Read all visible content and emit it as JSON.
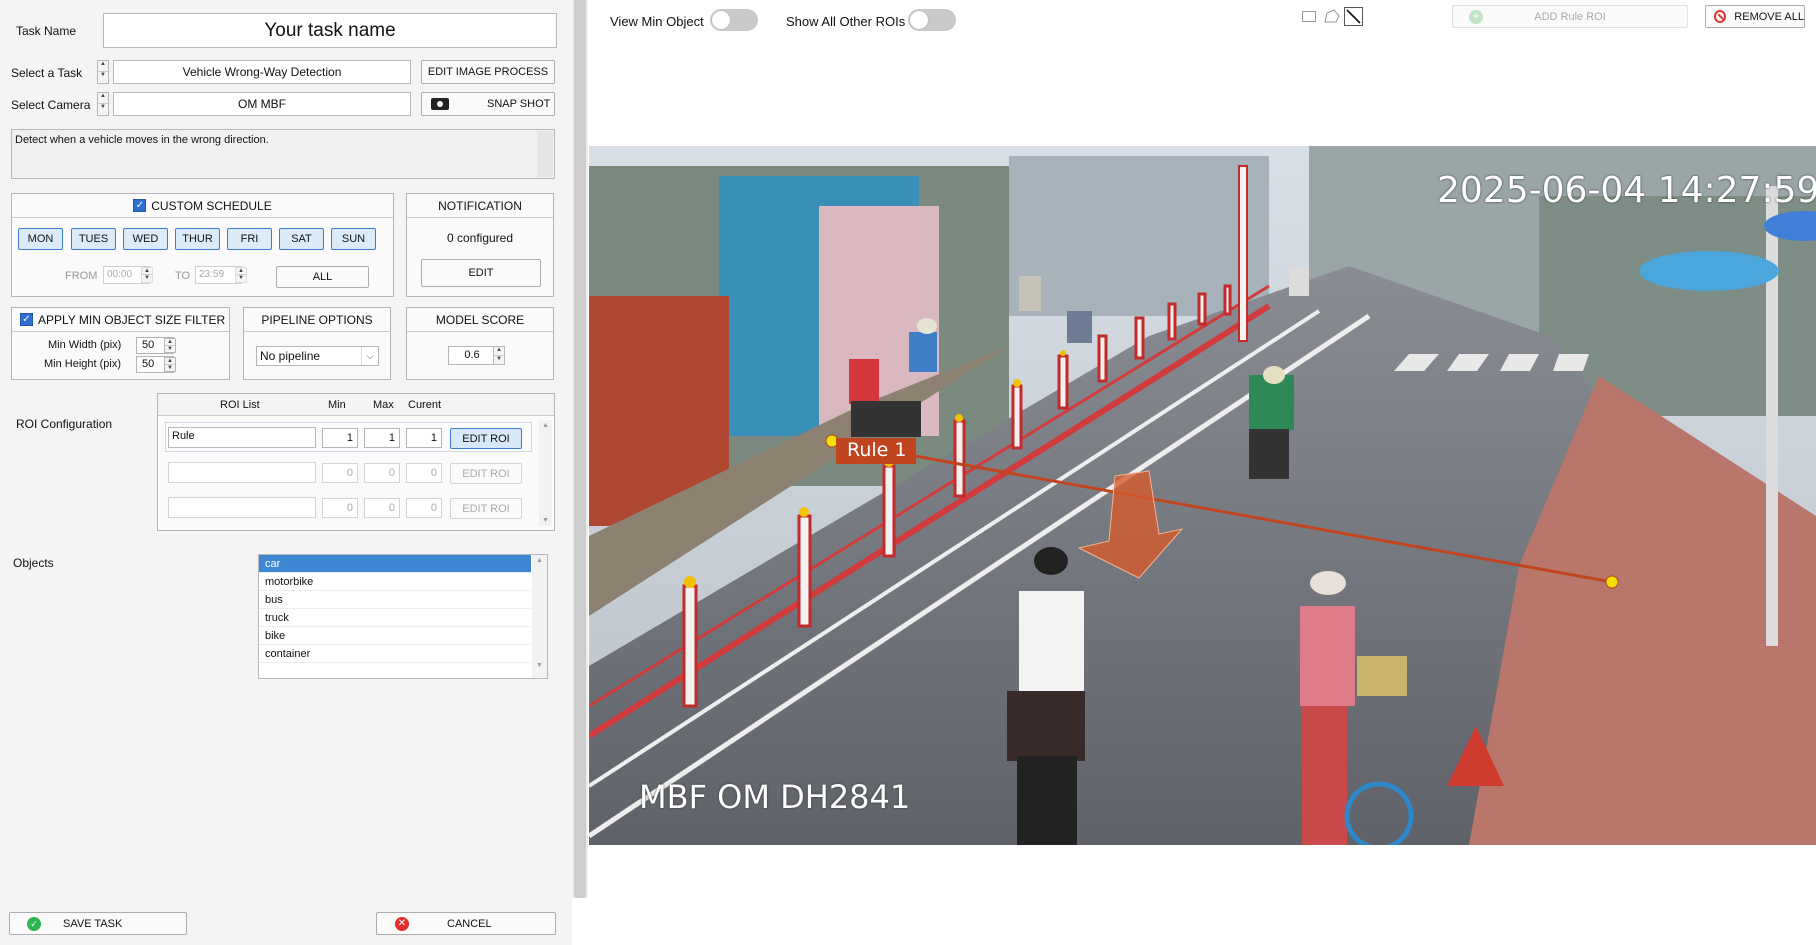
{
  "task": {
    "name_label": "Task Name",
    "name_value": "Your task name",
    "select_task_label": "Select a Task",
    "select_task_value": "Vehicle Wrong-Way Detection",
    "edit_image_process": "EDIT IMAGE PROCESS",
    "select_camera_label": "Select Camera",
    "select_camera_value": "OM MBF",
    "snap_shot": "SNAP SHOT",
    "description": "Detect when a vehicle moves in the wrong direction."
  },
  "schedule": {
    "title": "CUSTOM SCHEDULE",
    "days": [
      "MON",
      "TUES",
      "WED",
      "THUR",
      "FRI",
      "SAT",
      "SUN"
    ],
    "from_label": "FROM",
    "from_value": "00:00",
    "to_label": "TO",
    "to_value": "23:59",
    "all_label": "ALL"
  },
  "notification": {
    "title": "NOTIFICATION",
    "status": "0 configured",
    "edit_label": "EDIT"
  },
  "size_filter": {
    "title": "APPLY MIN OBJECT SIZE FILTER",
    "min_width_label": "Min Width (pix)",
    "min_width_value": "50",
    "min_height_label": "Min Height (pix)",
    "min_height_value": "50"
  },
  "pipeline": {
    "title": "PIPELINE OPTIONS",
    "value": "No pipeline"
  },
  "model_score": {
    "title": "MODEL SCORE",
    "value": "0.6"
  },
  "roi": {
    "section_label": "ROI Configuration",
    "headers": {
      "list": "ROI List",
      "min": "Min",
      "max": "Max",
      "current": "Curent"
    },
    "rows": [
      {
        "name": "Rule",
        "min": "1",
        "max": "1",
        "current": "1",
        "button": "EDIT ROI"
      },
      {
        "name": "",
        "min": "0",
        "max": "0",
        "current": "0",
        "button": "EDIT ROI"
      },
      {
        "name": "",
        "min": "0",
        "max": "0",
        "current": "0",
        "button": "EDIT ROI"
      }
    ]
  },
  "objects": {
    "label": "Objects",
    "items": [
      "car",
      "motorbike",
      "bus",
      "truck",
      "bike",
      "container"
    ],
    "selected": "car"
  },
  "footer": {
    "save_label": "SAVE TASK",
    "cancel_label": "CANCEL"
  },
  "toolbar": {
    "view_min_object": "View Min Object",
    "show_all_rois": "Show All Other ROIs",
    "add_rule_roi": "ADD Rule ROI",
    "remove_all": "REMOVE ALL"
  },
  "camera": {
    "timestamp": "2025-06-04 14:27:59",
    "watermark": "MBF OM DH2841",
    "rule_label": "Rule 1",
    "rule_color": "#c0451f"
  }
}
